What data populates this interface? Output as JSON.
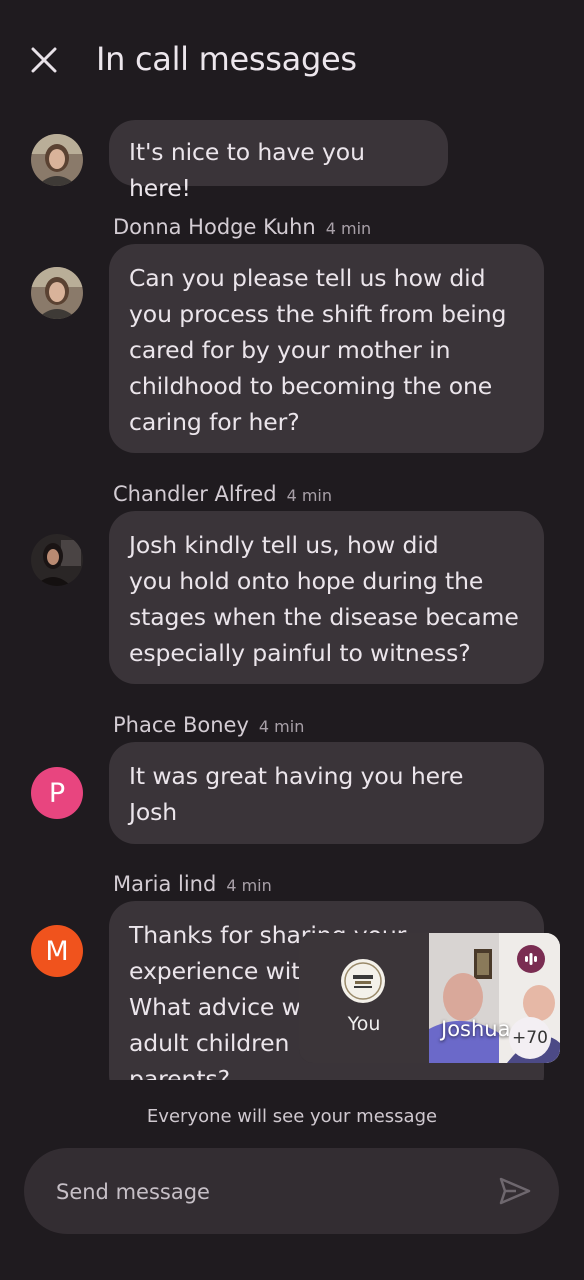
{
  "header": {
    "close_icon": "close-icon",
    "title": "In call messages"
  },
  "messages": [
    {
      "sender": "",
      "time": "",
      "avatar_type": "photo",
      "text": "It's nice to have you here!"
    },
    {
      "sender": "Donna Hodge Kuhn",
      "time": "4 min",
      "avatar_type": "photo",
      "lines": [
        "Can you please tell us how did",
        "you process the shift from being",
        "cared for by your mother in",
        "childhood to becoming the one",
        "caring for her?"
      ]
    },
    {
      "sender": "Chandler Alfred",
      "time": "4 min",
      "avatar_type": "photo",
      "lines": [
        "Josh kindly tell us, how did",
        "you hold onto hope during the",
        "stages when the disease became",
        "especially painful to witness?"
      ]
    },
    {
      "sender": "Phace Boney",
      "time": "4 min",
      "avatar_type": "letter",
      "avatar_letter": "P",
      "avatar_color": "#e8457f",
      "lines": [
        "It was great having you here",
        "Josh"
      ]
    },
    {
      "sender": "Maria lind",
      "time": "4 min",
      "avatar_type": "letter",
      "avatar_letter": "M",
      "avatar_color": "#f0531d",
      "lines": [
        "Thanks for sharing your",
        "experience with",
        "What advice w",
        "adult children",
        "parents?"
      ]
    }
  ],
  "pip": {
    "self_label": "You",
    "remote_name": "Joshua",
    "others_count": "+70",
    "audio_icon": "audio-level-icon"
  },
  "footer": {
    "notice": "Everyone will see your message",
    "input_placeholder": "Send message",
    "send_icon": "send-icon"
  },
  "colors": {
    "background": "#1f1b1f",
    "bubble": "#3a3439",
    "composer": "#332d32"
  }
}
